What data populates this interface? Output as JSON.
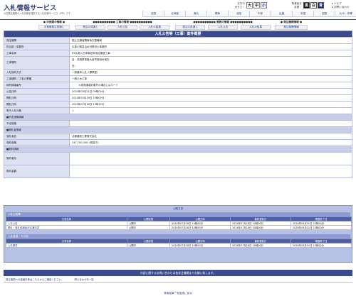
{
  "header": {
    "title": "入札情報サービス",
    "subtitle": "公共発注機関の入札情報を提供する入札情報サービス（PPI）です",
    "font_size_label_1": "文字の",
    "font_size_label_2": "大きさ：",
    "font_sizes": [
      "大",
      "中",
      "小"
    ],
    "bg_label_1": "背景色を",
    "bg_label_2": "変更：",
    "bg_colors": [
      "黒",
      "白",
      "青"
    ],
    "help_link": "ヘルプ",
    "contact_link": "お問い合わせ",
    "regions": [
      "全国",
      "北海道",
      "東北",
      "関東",
      "北陸",
      "中部",
      "近畿",
      "中国",
      "四国",
      "九州・沖縄"
    ]
  },
  "nav": {
    "groups": [
      {
        "title": "● 中長期の情報 ●",
        "items": [
          "中長期発注見通し"
        ]
      },
      {
        "title": "●●●●●●●●●● 工事の情報 ●●●●●●●●●●",
        "items": [
          "発注の見通し",
          "入札公告",
          "入札の結果"
        ]
      },
      {
        "title": "●●●●●●●●●● 業務の情報 ●●●●●●●●●●",
        "items": [
          "発注の見通し",
          "入札公告",
          "入札の結果"
        ]
      },
      {
        "title": "● 発注機関情報 ●",
        "items": [
          "発注機関情報"
        ]
      }
    ]
  },
  "detail": {
    "title": "入札公告等（工事）案件概要",
    "rows": [
      {
        "label": "発注機関",
        "value": "国土交通省関東地方整備局"
      },
      {
        "label": "担当部・事務所",
        "value": "久慈川緊急治水対策河川事務所"
      },
      {
        "label": "工事名称",
        "value": "R5久慈川左岸南田気地区築堤工事"
      },
      {
        "label": "工事場所",
        "value": "自：茨城県常陸大宮市南田気地先",
        "value2": "至："
      },
      {
        "label": "入札契約方式",
        "value": "一般競争入札（標準型）"
      },
      {
        "label": "工事種別／工事の業種",
        "value": "一般土木工事"
      },
      {
        "label": "政府調達番号",
        "value": "＊政府調達対象外の場合にはコード"
      },
      {
        "label": "公告日時",
        "value": "2024年05月21日 09時00分"
      },
      {
        "label": "開札日時",
        "value": "2024年05月29日 15時00分"
      },
      {
        "label": "開札日時",
        "value": "2024年07月10日 13時15分"
      },
      {
        "label": "電子入札対象",
        "value": "○"
      }
    ],
    "section_price": "■予定価格情報",
    "price_label": "予定価格",
    "price_value": "",
    "section_winner": "■落札者情報",
    "winner_name_label": "落札者名",
    "winner_name": "北都建設工業株式会社",
    "winner_amount_label": "落札価格",
    "winner_amount": "247,700,000（税抜き）",
    "section_contract": "■契約情報",
    "contract_label": "契約者名",
    "contract_amount_label": "契約金額",
    "contract_value": "",
    "contract_amount": ""
  },
  "docs": {
    "title": "公開文書",
    "group1_title": "入札公告等",
    "headers": [
      "文書名称",
      "公開状態",
      "公開日時",
      "最終更新日",
      "掲載終了日"
    ],
    "group1_rows": [
      [
        "入札公告",
        "公開中",
        "2024年07月18日 10時00分",
        "2024年07月18日 10時00分",
        "2026年03月31日 23時00分"
      ],
      [
        "開札・落札候補者決定通知書",
        "公開中",
        "2024年07月18日 10時00分",
        "2024年07月18日 10時00分",
        "2026年03月31日 23時00分"
      ]
    ],
    "group2_title": "入札経過・その他",
    "group2_rows": [
      [
        "入札調書",
        "公開中",
        "2024年07月18日 10時00分",
        "2024年07月18日 10時00分",
        "2026年03月31日 23時00分"
      ]
    ]
  },
  "footer": {
    "contact_bar": "内容に関するお問い合わせは各発注機関までお願い致します。",
    "contact_links": [
      "発注機関への連絡先等はこちらからご確認ください。",
      "問い合わせ先一覧"
    ],
    "back": "検索結果一覧画面に戻る"
  }
}
